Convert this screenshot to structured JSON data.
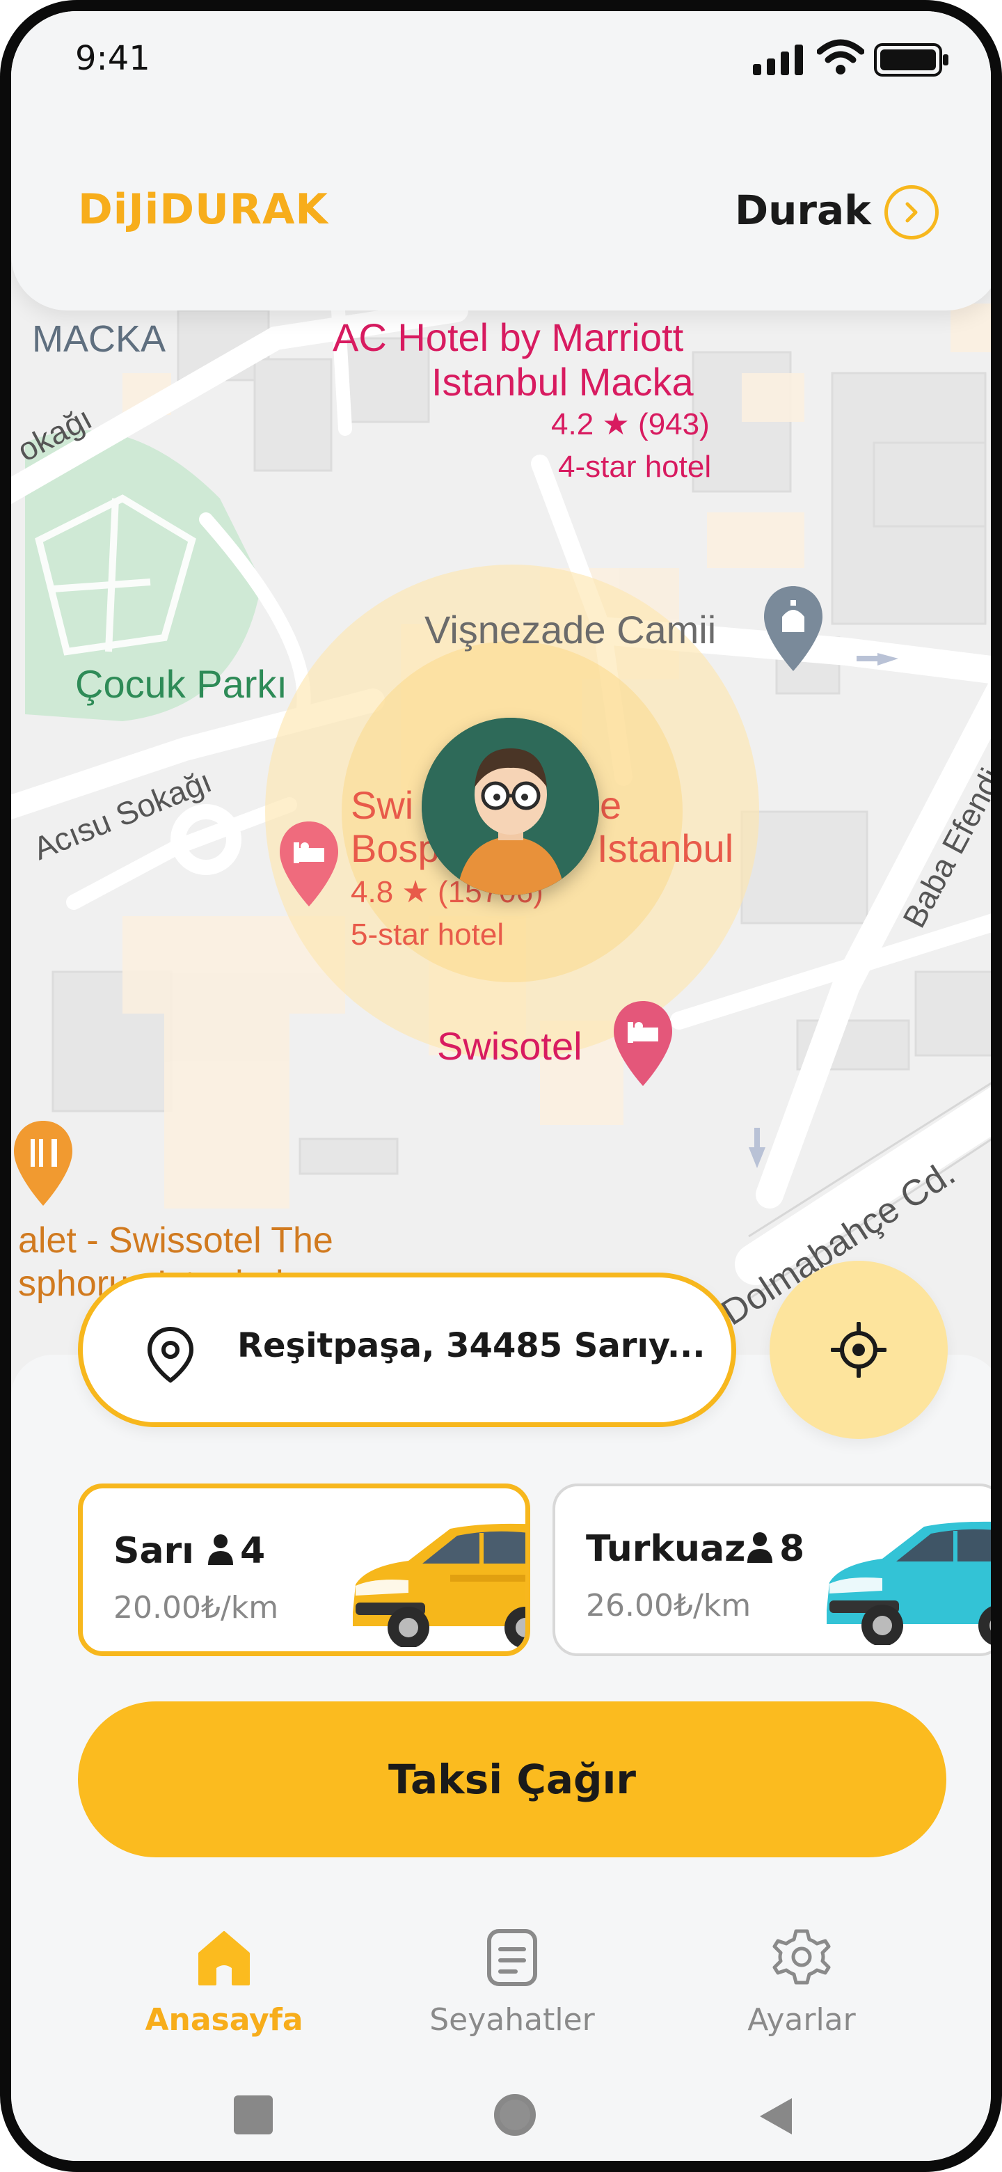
{
  "status_bar": {
    "time": "9:41"
  },
  "header": {
    "logo": "DiJiDURAK",
    "durak_label": "Durak"
  },
  "map": {
    "labels": {
      "macka": "MACKA",
      "hotel1_name_line1": "AC Hotel by Marriott",
      "hotel1_name_line2": "Istanbul Macka",
      "hotel1_rating": "4.2 ★ (943)",
      "hotel1_class": "4-star hotel",
      "sokagi_top": "okağı",
      "mosque": "Vişnezade Camii",
      "park": "Çocuk Parkı",
      "acisu": "Acısu Sokağı",
      "hotel2_part1": "Swi",
      "hotel2_part1b": "e",
      "hotel2_part2": "Bosp",
      "hotel2_part2b": "Istanbul",
      "hotel2_rating": "4.8 ★ (15706)",
      "hotel2_class": "5-star hotel",
      "baba_efendi": "Baba Efendi Sk.",
      "swisotel": "Swisotel",
      "dolmabahce": "Dolmabahçe Cd.",
      "restaurant_line1": "alet - Swissotel The",
      "restaurant_line2": "sphorus Istanbul"
    }
  },
  "location": {
    "address": "Reşitpaşa, 34485 Sarıy..."
  },
  "vehicles": [
    {
      "name": "Sarı",
      "seats": "4",
      "price": "20.00₺/km",
      "color": "#f7b71d",
      "selected": true
    },
    {
      "name": "Turkuaz",
      "seats": "8",
      "price": "26.00₺/km",
      "color": "#2fc6d8",
      "selected": false
    }
  ],
  "call_button": {
    "label": "Taksi Çağır"
  },
  "bottom_nav": [
    {
      "label": "Anasayfa",
      "icon": "home-icon",
      "active": true
    },
    {
      "label": "Seyahatler",
      "icon": "document-icon",
      "active": false
    },
    {
      "label": "Ayarlar",
      "icon": "gear-icon",
      "active": false
    }
  ],
  "colors": {
    "accent": "#fbbb1f",
    "accent_light": "#fde49d",
    "hotel_pink": "#d81b60",
    "park_green": "#2e8b57"
  }
}
